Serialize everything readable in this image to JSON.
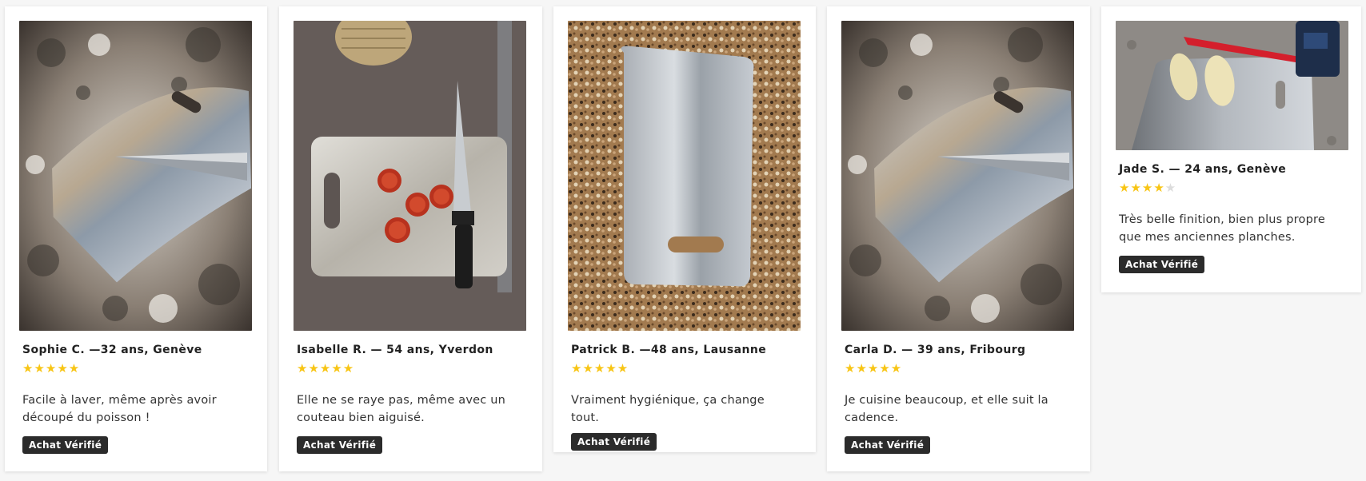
{
  "reviews": [
    {
      "name": "Sophie C. —32 ans, Genève",
      "rating": 5,
      "stars": "★★★★★",
      "text": "Facile à laver, même après avoir découpé du poisson !",
      "badge": "Achat Vérifié",
      "photo": "steel-cutting-board-with-knife-on-granite"
    },
    {
      "name": "Isabelle R. — 54 ans, Yverdon",
      "rating": 5,
      "stars": "★★★★★",
      "text": "Elle ne se raye pas, même avec un couteau bien aiguisé.",
      "badge": "Achat Vérifié",
      "photo": "steel-cutting-board-with-tomatoes-and-chef-knife"
    },
    {
      "name": "Patrick B. —48 ans, Lausanne",
      "rating": 5,
      "stars": "★★★★★",
      "text": "Vraiment hygiénique, ça change tout.",
      "badge": "Achat Vérifié",
      "photo": "steel-cutting-board-on-speckled-counter"
    },
    {
      "name": "Carla D. — 39 ans, Fribourg",
      "rating": 5,
      "stars": "★★★★★",
      "text": "Je cuisine beaucoup, et elle suit la cadence.",
      "badge": "Achat Vérifié",
      "photo": "steel-cutting-board-with-knife-on-granite"
    },
    {
      "name": "Jade S. — 24 ans, Genève",
      "rating": 4,
      "stars_on": "★★★★",
      "stars_off": "★",
      "text": "Très belle finition, bien plus propre que mes anciennes planches.",
      "badge": "Achat Vérifié",
      "photo": "steel-cutting-board-with-potatoes-and-red-knife"
    }
  ],
  "colors": {
    "star": "#f8c515",
    "star_empty": "#dcdcdc",
    "badge_bg": "#2b2b2b",
    "page_bg": "#f6f6f6"
  }
}
